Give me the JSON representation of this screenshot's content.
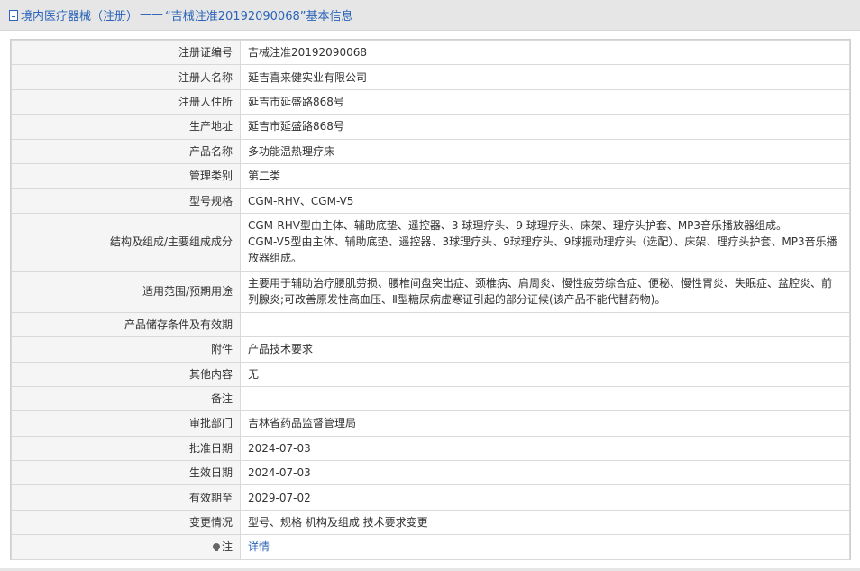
{
  "header": {
    "category": "境内医疗器械（注册）",
    "separator": "——",
    "reg_title": "“吉械注准20192090068”基本信息"
  },
  "rows": [
    {
      "label": "注册证编号",
      "value": "吉械注准20192090068"
    },
    {
      "label": "注册人名称",
      "value": "延吉喜来健实业有限公司"
    },
    {
      "label": "注册人住所",
      "value": "延吉市延盛路868号"
    },
    {
      "label": "生产地址",
      "value": "延吉市延盛路868号"
    },
    {
      "label": "产品名称",
      "value": "多功能温热理疗床"
    },
    {
      "label": "管理类别",
      "value": "第二类"
    },
    {
      "label": "型号规格",
      "value": "CGM-RHV、CGM-V5"
    },
    {
      "label": "结构及组成/主要组成成分",
      "value_line1": "CGM-RHV型由主体、辅助底垫、遥控器、3 球理疗头、9 球理疗头、床架、理疗头护套、MP3音乐播放器组成。",
      "value_line2": "CGM-V5型由主体、辅助底垫、遥控器、3球理疗头、9球理疗头、9球振动理疗头（选配）、床架、理疗头护套、MP3音乐播放器组成。"
    },
    {
      "label": "适用范围/预期用途",
      "value": "主要用于辅助治疗腰肌劳损、腰椎间盘突出症、颈椎病、肩周炎、慢性疲劳综合症、便秘、慢性胃炎、失眠症、盆腔炎、前列腺炎;可改善原发性高血压、Ⅱ型糖尿病虚寒证引起的部分证候(该产品不能代替药物)。"
    },
    {
      "label": "产品储存条件及有效期",
      "value": ""
    },
    {
      "label": "附件",
      "value": "产品技术要求"
    },
    {
      "label": "其他内容",
      "value": "无"
    },
    {
      "label": "备注",
      "value": ""
    },
    {
      "label": "审批部门",
      "value": "吉林省药品监督管理局"
    },
    {
      "label": "批准日期",
      "value": "2024-07-03"
    },
    {
      "label": "生效日期",
      "value": "2024-07-03"
    },
    {
      "label": "有效期至",
      "value": "2029-07-02"
    },
    {
      "label": "变更情况",
      "value": "型号、规格 机构及组成 技术要求变更"
    },
    {
      "label": "注",
      "value": "详情",
      "icon": "lightbulb-icon"
    }
  ],
  "colors": {
    "link": "#2b64b8",
    "label_bg": "#f5f5f5",
    "header_bg": "#e6e6e6"
  }
}
